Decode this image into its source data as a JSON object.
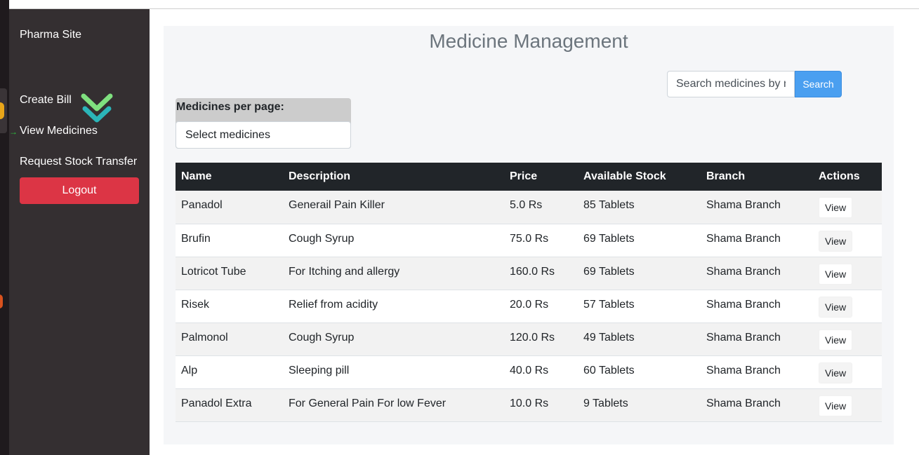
{
  "brand": "Pharma Site",
  "nav": {
    "create_bill": "Create Bill",
    "view_medicines": "View Medicines",
    "request_stock_transfer": "Request Stock Transfer",
    "logout": "Logout"
  },
  "main": {
    "title": "Medicine Management",
    "search_placeholder": "Search medicines by name",
    "search_button": "Search",
    "per_page_label": "Medicines per page:",
    "per_page_value": "Select medicines"
  },
  "table": {
    "headers": [
      "Name",
      "Description",
      "Price",
      "Available Stock",
      "Branch",
      "Actions"
    ],
    "rows": [
      {
        "name": "Panadol",
        "description": "Generail Pain Killer",
        "price": "5.0 Rs",
        "stock": "85 Tablets",
        "branch": "Shama Branch",
        "action": "View"
      },
      {
        "name": "Brufin",
        "description": "Cough Syrup",
        "price": "75.0 Rs",
        "stock": "69 Tablets",
        "branch": "Shama Branch",
        "action": "View"
      },
      {
        "name": "Lotricot Tube",
        "description": "For Itching and allergy",
        "price": "160.0 Rs",
        "stock": "69 Tablets",
        "branch": "Shama Branch",
        "action": "View"
      },
      {
        "name": "Risek",
        "description": "Relief from acidity",
        "price": "20.0 Rs",
        "stock": "57 Tablets",
        "branch": "Shama Branch",
        "action": "View"
      },
      {
        "name": "Palmonol",
        "description": "Cough Syrup",
        "price": "120.0 Rs",
        "stock": "49 Tablets",
        "branch": "Shama Branch",
        "action": "View"
      },
      {
        "name": "Alp",
        "description": "Sleeping pill",
        "price": "40.0 Rs",
        "stock": "60 Tablets",
        "branch": "Shama Branch",
        "action": "View"
      },
      {
        "name": "Panadol Extra",
        "description": "For General Pain For low Fever",
        "price": "10.0 Rs",
        "stock": "9 Tablets",
        "branch": "Shama Branch",
        "action": "View"
      }
    ]
  },
  "icons": {
    "cursor_indicator": "double-chevron-down-icon",
    "nav_pointer": "arrow-right-icon"
  },
  "colors": {
    "sidebar_bg": "#342f31",
    "logout_red": "#dc3545",
    "search_blue": "#4a9ff0",
    "table_header": "#212529"
  }
}
